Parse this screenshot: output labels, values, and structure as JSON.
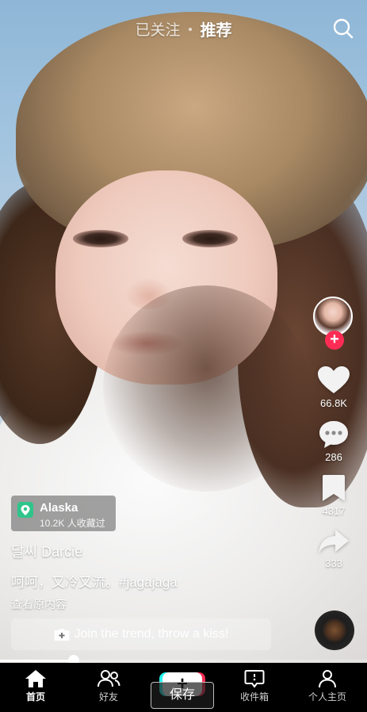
{
  "top_nav": {
    "following": "已关注",
    "recommended": "推荐"
  },
  "icons": {
    "search": "search-icon",
    "like": "heart-icon",
    "comment": "comment-icon",
    "favorite": "bookmark-icon",
    "share": "share-icon",
    "location": "location-pin-icon",
    "trend": "camera-plus-icon",
    "home": "home-icon",
    "friends": "friends-icon",
    "inbox": "inbox-icon",
    "profile": "profile-icon"
  },
  "rail": {
    "likes": "66.8K",
    "comments": "286",
    "favorites": "4317",
    "shares": "333",
    "follow_symbol": "+"
  },
  "location": {
    "name": "Alaska",
    "saves": "10.2K 人收藏过"
  },
  "post": {
    "author": "달씨 Darcie",
    "caption": "呵呵，又冷又流。",
    "hashtag": "#jagajaga",
    "view_original": "查看原内容",
    "trend_button": "Join the trend, throw a kiss!"
  },
  "progress": {
    "played_fraction": 0.2
  },
  "tabbar": {
    "home": "首页",
    "friends": "好友",
    "create": "+",
    "save_overlay": "保存",
    "inbox": "收件箱",
    "profile": "个人主页"
  },
  "colors": {
    "accent": "#fe2c55",
    "cyan": "#25f4ee",
    "location_pin": "#2fc58a"
  }
}
